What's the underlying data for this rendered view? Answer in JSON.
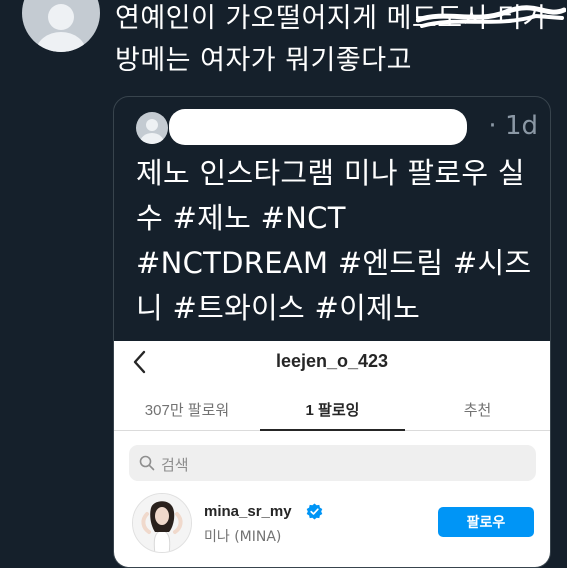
{
  "reply": {
    "text": "연예인이 가오떨어지게 메드도시 티가방메는 여자가 뭐기좋다고"
  },
  "quoted_tweet": {
    "time": "· 1d",
    "text": "제노 인스타그램 미나 팔로우 실수 #제노 #NCT #NCTDREAM #엔드림 #시즈니 #트와이스 #이제노"
  },
  "instagram": {
    "username": "leejen_o_423",
    "tabs": [
      {
        "label": "307만 팔로워",
        "active": false
      },
      {
        "label": "1 팔로잉",
        "active": true
      },
      {
        "label": "추천",
        "active": false
      }
    ],
    "search_placeholder": "검색",
    "following_user": {
      "handle": "mina_sr_my",
      "display_name": "미나 (MINA)",
      "verified": true
    },
    "follow_button_label": "팔로우"
  },
  "icons": {
    "back": "chevron-left-icon",
    "search": "search-icon",
    "verified": "verified-badge-icon"
  },
  "colors": {
    "background": "#15202b",
    "accent": "#0095f6",
    "muted": "#8b98a5"
  }
}
